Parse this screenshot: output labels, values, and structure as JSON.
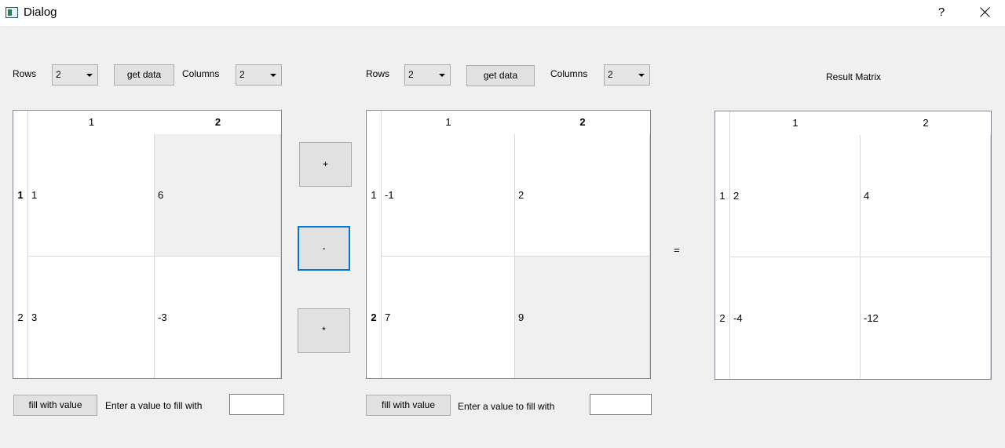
{
  "window": {
    "title": "Dialog",
    "help": "?"
  },
  "left": {
    "rows_label": "Rows",
    "rows_value": "2",
    "get_data": "get data",
    "columns_label": "Columns",
    "columns_value": "2",
    "col_headers": [
      "1",
      "2"
    ],
    "row_headers": [
      "1",
      "2"
    ],
    "cells": [
      [
        "1",
        "6"
      ],
      [
        "3",
        "-3"
      ]
    ],
    "fill_button": "fill with value",
    "fill_label": "Enter a value to fill with",
    "fill_value": ""
  },
  "ops": {
    "plus": "+",
    "minus": "-",
    "times": "*",
    "equals": "="
  },
  "right": {
    "rows_label": "Rows",
    "rows_value": "2",
    "get_data": "get data",
    "columns_label": "Columns",
    "columns_value": "2",
    "col_headers": [
      "1",
      "2"
    ],
    "row_headers": [
      "1",
      "2"
    ],
    "cells": [
      [
        "-1",
        "2"
      ],
      [
        "7",
        "9"
      ]
    ],
    "fill_button": "fill with value",
    "fill_label": "Enter a value to fill with",
    "fill_value": ""
  },
  "result": {
    "label": "Result Matrix",
    "col_headers": [
      "1",
      "2"
    ],
    "row_headers": [
      "1",
      "2"
    ],
    "cells": [
      [
        "2",
        "4"
      ],
      [
        "-4",
        "-12"
      ]
    ]
  }
}
